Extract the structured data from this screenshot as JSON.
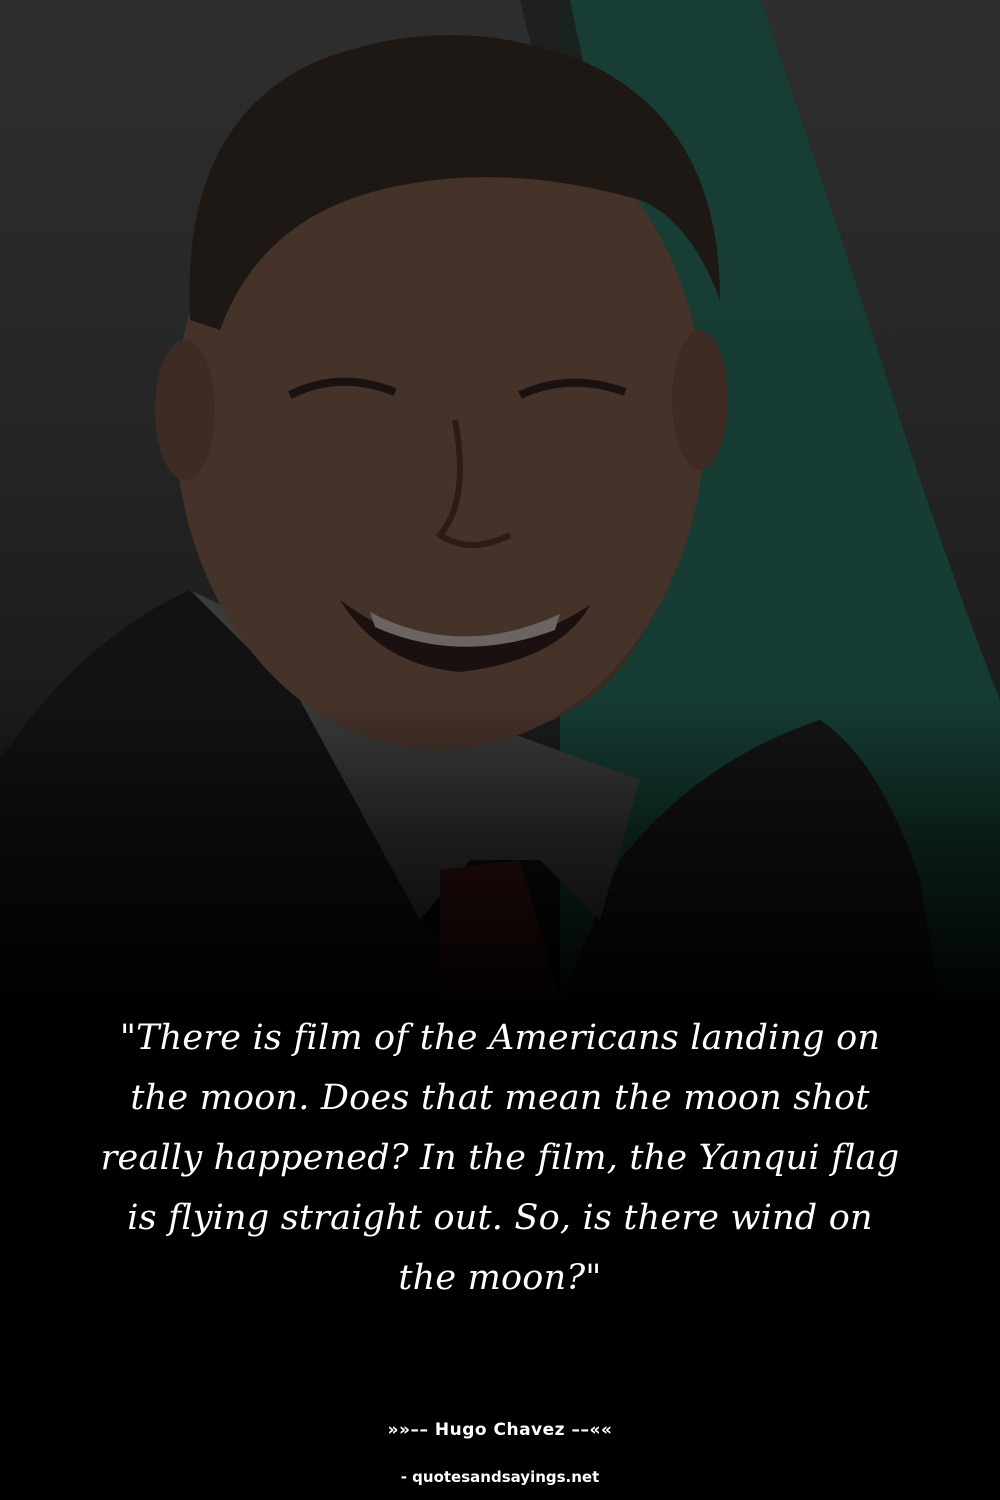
{
  "quote": {
    "text": "\"There is film of the Americans landing on the moon. Does that mean the moon shot really happened? In the film, the Yanqui flag is flying straight out. So, is there wind on the moon?\""
  },
  "author": {
    "text": "»»–– Hugo Chavez ––««"
  },
  "source": {
    "text": "- quotesandsayings.net"
  },
  "colors": {
    "background": "#000000",
    "text": "#ffffff",
    "flag_green": "#153f35"
  }
}
